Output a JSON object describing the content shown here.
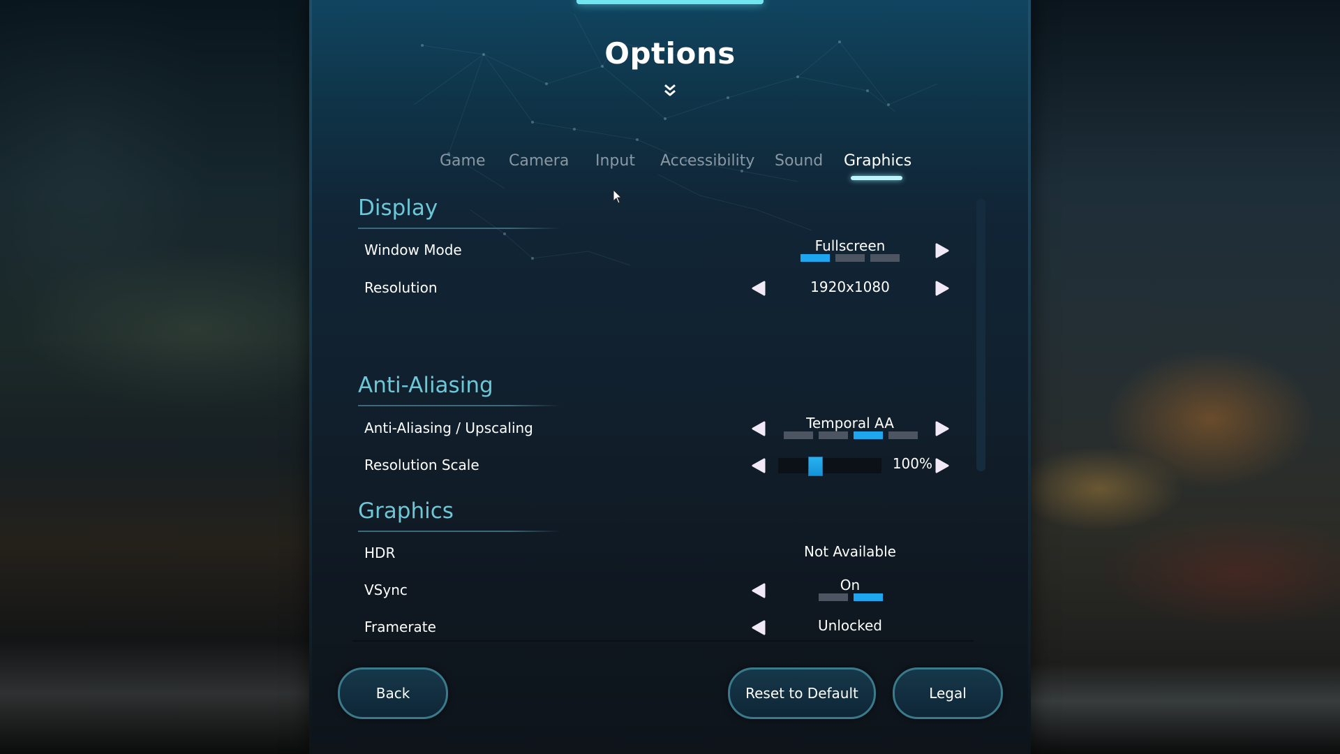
{
  "header": {
    "title": "Options",
    "expand_icon": "double-chevron-down-icon"
  },
  "tabs": [
    {
      "label": "Game",
      "active": false
    },
    {
      "label": "Camera",
      "active": false
    },
    {
      "label": "Input",
      "active": false
    },
    {
      "label": "Accessibility",
      "active": false
    },
    {
      "label": "Sound",
      "active": false
    },
    {
      "label": "Graphics",
      "active": true
    }
  ],
  "sections": {
    "display": {
      "title": "Display",
      "rows": {
        "window_mode": {
          "label": "Window Mode",
          "value": "Fullscreen",
          "option_count": 3,
          "selected_index": 0
        },
        "resolution": {
          "label": "Resolution",
          "value": "1920x1080"
        }
      }
    },
    "anti_aliasing": {
      "title": "Anti-Aliasing",
      "rows": {
        "aa_upscaling": {
          "label": "Anti-Aliasing / Upscaling",
          "value": "Temporal AA",
          "option_count": 4,
          "selected_index": 2
        },
        "resolution_scale": {
          "label": "Resolution Scale",
          "value": "100%",
          "slider_fraction": 0.33
        }
      }
    },
    "graphics": {
      "title": "Graphics",
      "rows": {
        "hdr": {
          "label": "HDR",
          "value": "Not Available"
        },
        "vsync": {
          "label": "VSync",
          "value": "On",
          "option_count": 2,
          "selected_index": 1
        },
        "framerate": {
          "label": "Framerate",
          "value": "Unlocked"
        }
      }
    }
  },
  "buttons": {
    "back": "Back",
    "reset": "Reset to Default",
    "legal": "Legal"
  },
  "colors": {
    "accent": "#1ea7ee",
    "section_title": "#6cc7d6",
    "pip_inactive": "#4d5563",
    "tab_inactive": "#8a98a4"
  }
}
